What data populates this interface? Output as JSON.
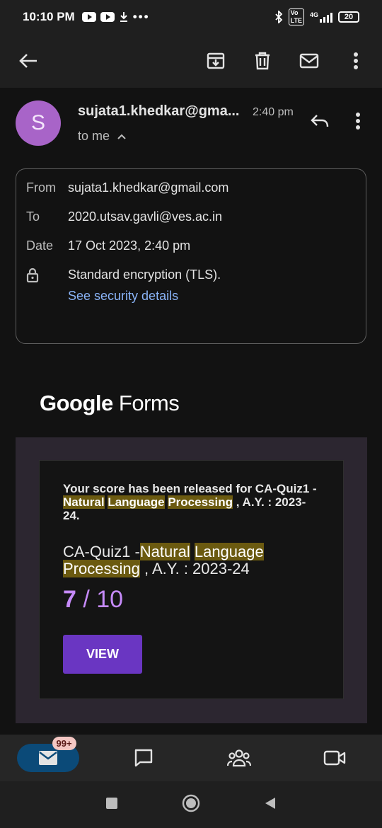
{
  "status_bar": {
    "time": "10:10 PM",
    "battery": "20",
    "network": "4G"
  },
  "toolbar": {
    "icons": [
      "back-arrow-icon",
      "archive-icon",
      "delete-icon",
      "mark-unread-icon",
      "more-vert-icon"
    ]
  },
  "email": {
    "sender_initial": "S",
    "sender_display": "sujata1.khedkar@gma...",
    "time": "2:40 pm",
    "recipient_summary": "to me",
    "details": {
      "from_label": "From",
      "from_value": "sujata1.khedkar@gmail.com",
      "to_label": "To",
      "to_value": "2020.utsav.gavli@ves.ac.in",
      "date_label": "Date",
      "date_value": "17 Oct 2023, 2:40 pm",
      "encryption": "Standard encryption (TLS).",
      "security_link": "See security details"
    }
  },
  "body": {
    "logo_google": "Google",
    "logo_forms": "Forms",
    "release_prefix": "Your score has been released for CA-Quiz1 -",
    "hl_1": "Natural",
    "hl_2": "Language",
    "hl_3": "Processing",
    "release_suffix": " , A.Y. : 2023-24.",
    "quiz_prefix": "CA-Quiz1 -",
    "quiz_suffix": " , A.Y. : 2023-24",
    "score_value": "7",
    "score_sep": " / ",
    "score_total": "10",
    "view_button": "VIEW"
  },
  "bottom_nav": {
    "mail_badge": "99+"
  },
  "colors": {
    "accent_purple": "#6a36c2",
    "score_purple": "#c58af9",
    "highlight": "#6b5a10",
    "avatar": "#a864c8",
    "link": "#8ab4f8"
  }
}
